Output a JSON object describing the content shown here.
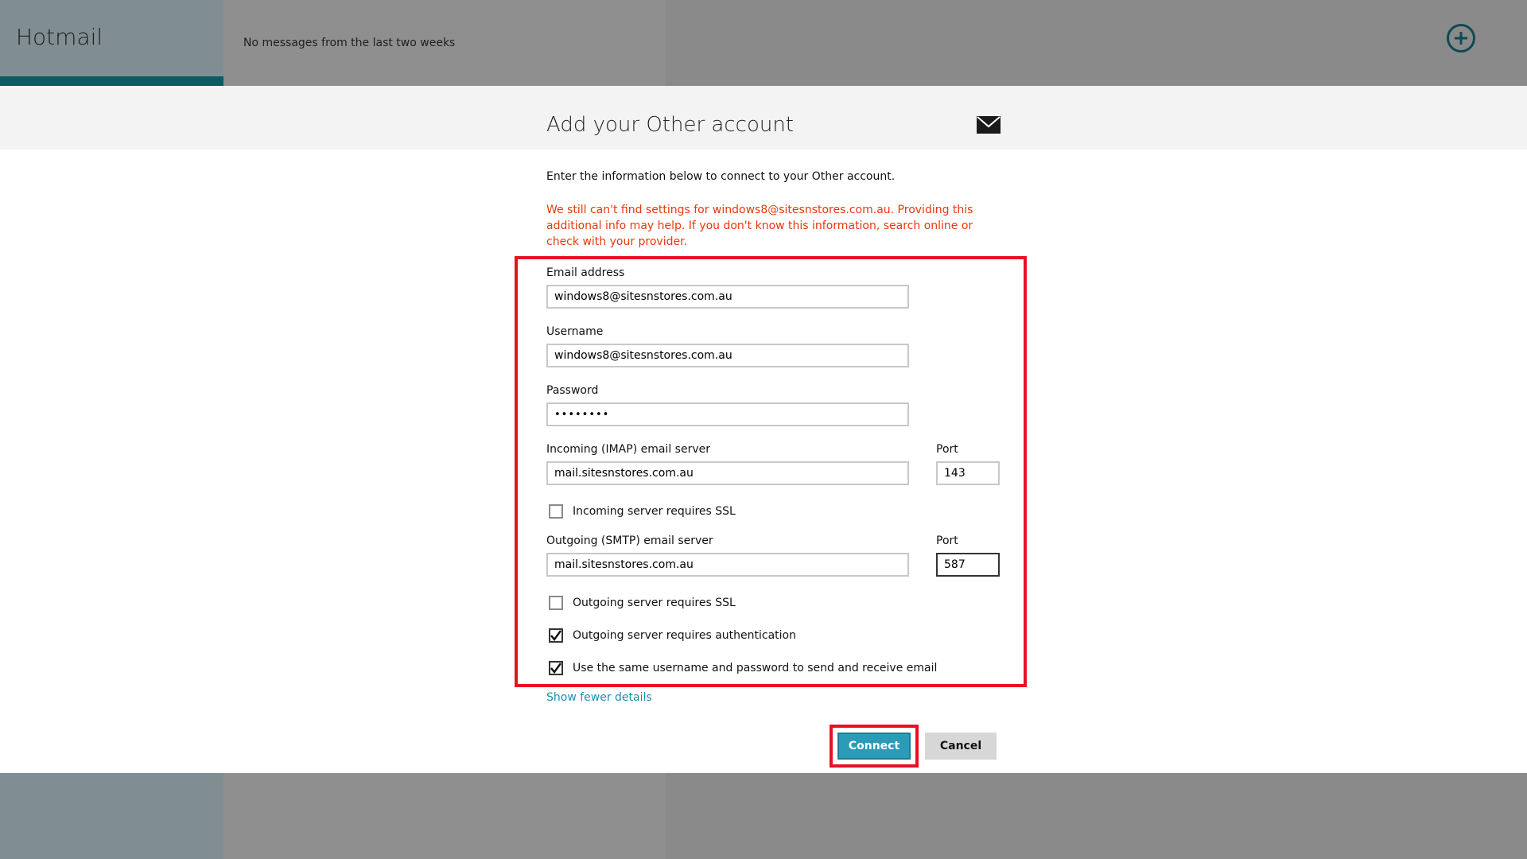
{
  "app": {
    "title": "Hotmail",
    "empty_message": "No messages from the last two weeks"
  },
  "dialog": {
    "title": "Add your Other account",
    "intro": "Enter the information below to connect to your Other account.",
    "warning": "We still can't find settings for windows8@sitesnstores.com.au. Providing this additional info may help. If you don't know this information, search online or check with your provider.",
    "email": {
      "label": "Email address",
      "value": "windows8@sitesnstores.com.au"
    },
    "username": {
      "label": "Username",
      "value": "windows8@sitesnstores.com.au"
    },
    "password": {
      "label": "Password",
      "value": "••••••••"
    },
    "incoming": {
      "label": "Incoming (IMAP) email server",
      "value": "mail.sitesnstores.com.au",
      "port_label": "Port",
      "port": "143"
    },
    "incoming_ssl": {
      "label": "Incoming server requires SSL",
      "checked": false
    },
    "outgoing": {
      "label": "Outgoing (SMTP) email server",
      "value": "mail.sitesnstores.com.au",
      "port_label": "Port",
      "port": "587"
    },
    "outgoing_ssl": {
      "label": "Outgoing server requires SSL",
      "checked": false
    },
    "outgoing_auth": {
      "label": "Outgoing server requires authentication",
      "checked": true
    },
    "same_credentials": {
      "label": "Use the same username and password to send and receive email",
      "checked": true
    },
    "show_fewer": "Show fewer details",
    "connect": "Connect",
    "cancel": "Cancel"
  },
  "colors": {
    "accent": "#2a9cb8",
    "warning": "#e8380d",
    "highlight": "#e81123",
    "link": "#1a8fb1"
  }
}
